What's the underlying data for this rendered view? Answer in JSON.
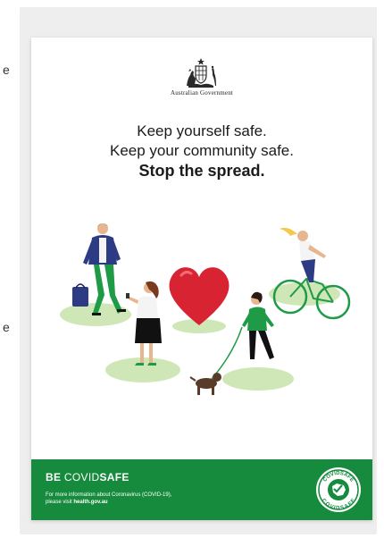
{
  "edge_labels": [
    "e",
    "e"
  ],
  "poster": {
    "government_label": "Australian Government",
    "headline_line1": "Keep yourself safe.",
    "headline_line2": "Keep your community safe.",
    "headline_line3": "Stop the spread.",
    "footer": {
      "title_be": "BE",
      "title_covid": "COVID",
      "title_safe": "SAFE",
      "info_line1": "For more information about Coronavirus (COVID-19),",
      "info_prefix": "please visit ",
      "info_link": "health.gov.au"
    },
    "badge": {
      "top_text": "COVIDSAFE",
      "bottom_text": "COVIDSAFE"
    }
  },
  "colors": {
    "green": "#168b3d",
    "light_green": "#cfe7b6",
    "heart_red": "#d82333",
    "navy": "#2d3a84"
  }
}
